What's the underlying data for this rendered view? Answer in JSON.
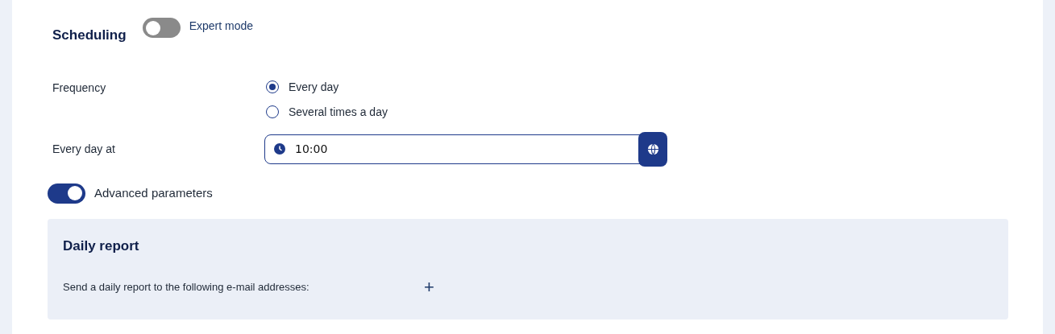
{
  "header": {
    "title": "Scheduling",
    "expert_mode": {
      "label": "Expert mode",
      "on": false
    }
  },
  "frequency": {
    "label": "Frequency",
    "options": [
      {
        "label": "Every day",
        "selected": true
      },
      {
        "label": "Several times a day",
        "selected": false
      }
    ]
  },
  "time": {
    "label": "Every day at",
    "value": "10:00"
  },
  "advanced": {
    "label": "Advanced parameters",
    "on": true
  },
  "daily_report": {
    "title": "Daily report",
    "text": "Send a daily report to the following e-mail addresses:",
    "add": "+"
  }
}
